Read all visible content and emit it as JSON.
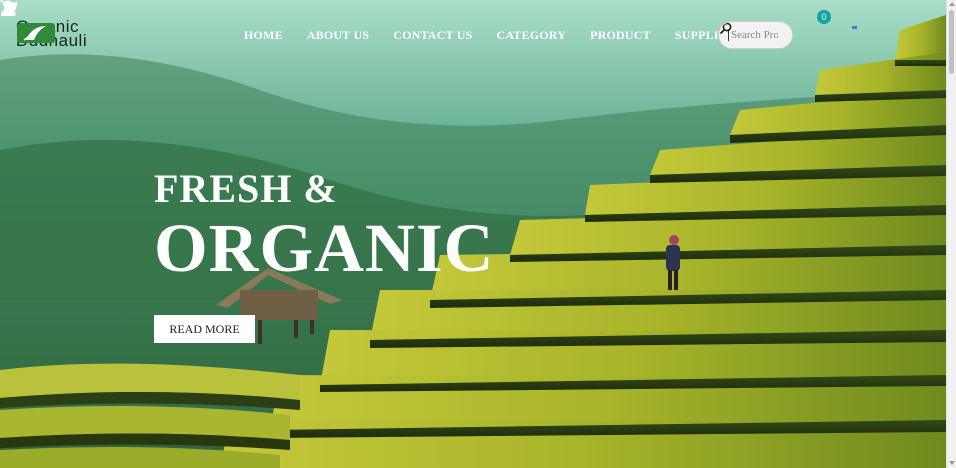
{
  "brand": {
    "line1": "Organic",
    "line2": "Dudhauli"
  },
  "nav": {
    "items": [
      {
        "label": "HOME"
      },
      {
        "label": "ABOUT US"
      },
      {
        "label": "CONTACT US"
      },
      {
        "label": "CATEGORY"
      },
      {
        "label": "PRODUCT"
      },
      {
        "label": "SUPPLIER"
      }
    ]
  },
  "search": {
    "placeholder": "Search Products"
  },
  "cart": {
    "count": "0"
  },
  "hero": {
    "line1": "FRESH &",
    "line2": "ORGANIC",
    "button": "READ MORE"
  },
  "icons": [
    "leaf-logo-icon",
    "search-icon",
    "cart-icon",
    "user-icon"
  ],
  "colors": {
    "nav_text": "#ffffff",
    "badge": "#14a3a3",
    "button_bg": "#ffffff"
  }
}
